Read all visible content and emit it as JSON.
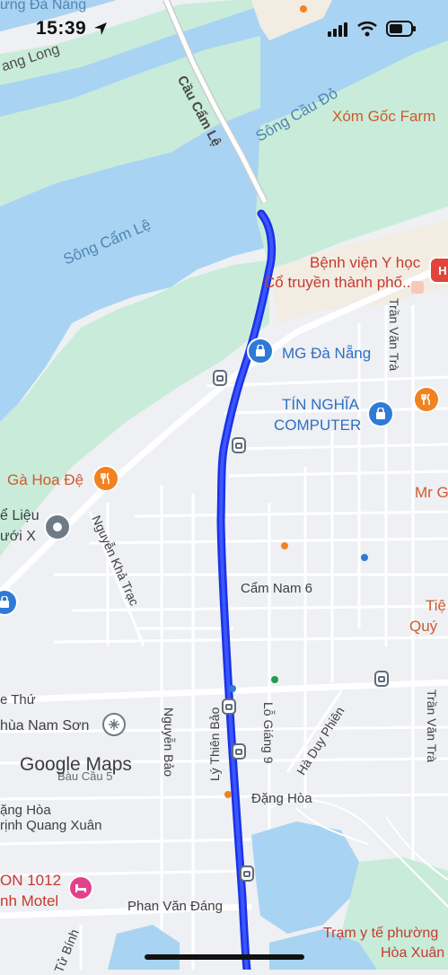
{
  "status_bar": {
    "time": "15:39",
    "location_icon": "location-arrow-icon",
    "signal_icon": "cellular-signal-icon",
    "wifi_icon": "wifi-icon",
    "battery_icon": "battery-icon"
  },
  "colors": {
    "water": "#a9d3f2",
    "park": "#c8ecd9",
    "route": "#1a33e6",
    "road": "#ffffff",
    "land": "#eef0f3"
  },
  "labels": {
    "top_left_place": "ưng Đà Nẵng",
    "thang_long": "ang Long",
    "cau_cam_le": "Cầu Cẩm Lệ",
    "song_cau_do": "Sông Cầu Đỏ",
    "xom_goc_farm": "Xóm Gốc Farm",
    "song_cam_le": "Sông Cẩm Lệ",
    "benh_vien_line1": "Bệnh viện Y học",
    "benh_vien_line2": "Cổ truyền thành phố...",
    "mg_da_nang": "MG Đà Nẵng",
    "tran_van_tra_top": "Trần Văn Trà",
    "tin_nghia_line1": "TÍN NGHĨA",
    "tin_nghia_line2": "COMPUTER",
    "ga_hoa_de": "Gà Hoa Đệ",
    "mr_g": "Mr G",
    "e_lieu_line1": "ể Liệu",
    "e_lieu_line2": "ưới X",
    "nguyen_kha_trac": "Nguyễn Khả Trạc",
    "cam_nam_6": "Cẩm Nam 6",
    "tien_line1": "Tiệ",
    "tien_line2": "Quý",
    "le_thu": "e Thứ",
    "chua_nam_son": "hùa Nam Sơn",
    "nguyen_bao": "Nguyễn Bảo",
    "ly_thien_bao": "Lý Thiên Bảo",
    "lo_giang_9": "Lỗ Giáng 9",
    "ha_duy_phien": "Hà Duy Phiên",
    "tran_van_tra_bottom": "Trần Văn Trà",
    "bau_cau": "Bàu Cầu 5",
    "dang_hoa_left": "ặng Hòa",
    "dang_hoa_right": "Đặng Hòa",
    "trinh_quang_xuan": "rịnh Quang Xuân",
    "on_1012_line1": "ON 1012",
    "on_1012_line2": "nh Motel",
    "phan_van_dang": "Phan Văn Đáng",
    "tu_binh": "Tử Bính",
    "tram_y_te": "Trạm y tế phường",
    "hoa_xuan": "Hòa Xuân"
  },
  "attribution": {
    "text": "Google Maps"
  },
  "icons": [
    "restaurant-icon",
    "shopping-bag-icon",
    "hospital-icon",
    "bus-stop-icon",
    "temple-icon",
    "hotel-icon",
    "viewpoint-icon"
  ]
}
